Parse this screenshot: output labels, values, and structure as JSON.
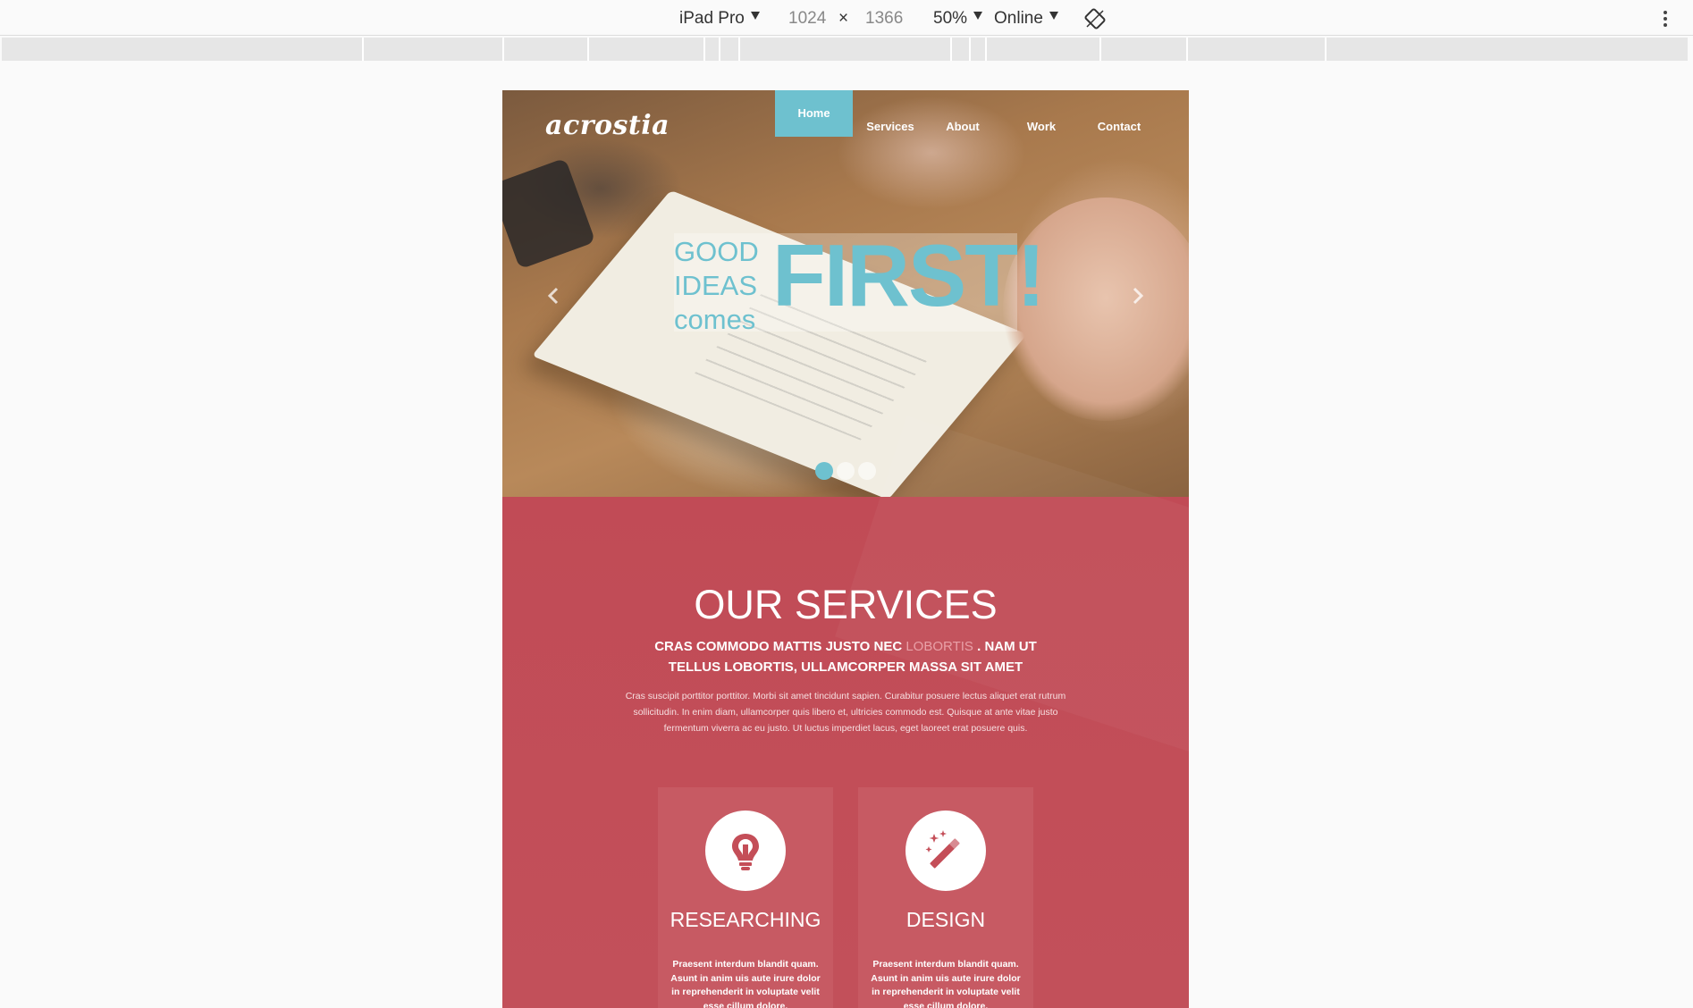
{
  "devtools": {
    "device": "iPad Pro",
    "width": "1024",
    "times": "×",
    "height": "1366",
    "zoom": "50%",
    "network": "Online"
  },
  "site": {
    "logo": "acrostia",
    "nav": [
      {
        "label": "Home",
        "active": true
      },
      {
        "label": "Services",
        "active": false
      },
      {
        "label": "About",
        "active": false
      },
      {
        "label": "Work",
        "active": false
      },
      {
        "label": "Contact",
        "active": false
      }
    ],
    "hero": {
      "line1": "GOOD",
      "line2": "IDEAS",
      "line3": "comes",
      "big": "FIRST!",
      "active_slide": 1,
      "slide_count": 3
    },
    "services": {
      "title": "OUR SERVICES",
      "sub_part1": "CRAS COMMODO MATTIS JUSTO NEC ",
      "sub_highlight": "LOBORTIS",
      "sub_part2": " . NAM UT TELLUS LOBORTIS, ULLAMCORPER MASSA SIT AMET",
      "body": "Cras suscipit porttitor porttitor. Morbi sit amet tincidunt sapien. Curabitur posuere lectus aliquet erat rutrum sollicitudin. In enim diam, ullamcorper quis libero et, ultricies commodo est. Quisque at ante vitae justo fermentum viverra ac eu justo. Ut luctus imperdiet lacus, eget laoreet erat posuere quis.",
      "cards": [
        {
          "title": "RESEARCHING",
          "icon": "lightbulb-icon",
          "text": "Praesent interdum blandit quam. Asunt in anim uis aute irure dolor in reprehenderit in voluptate velit esse cillum dolore."
        },
        {
          "title": "DESIGN",
          "icon": "magic-wand-icon",
          "text": "Praesent interdum blandit quam. Asunt in anim uis aute irure dolor in reprehenderit in voluptate velit esse cillum dolore."
        }
      ]
    }
  },
  "colors": {
    "accent": "#6ec1cf",
    "section_bg": "#c14b56",
    "card_bg": "#c75a63"
  }
}
